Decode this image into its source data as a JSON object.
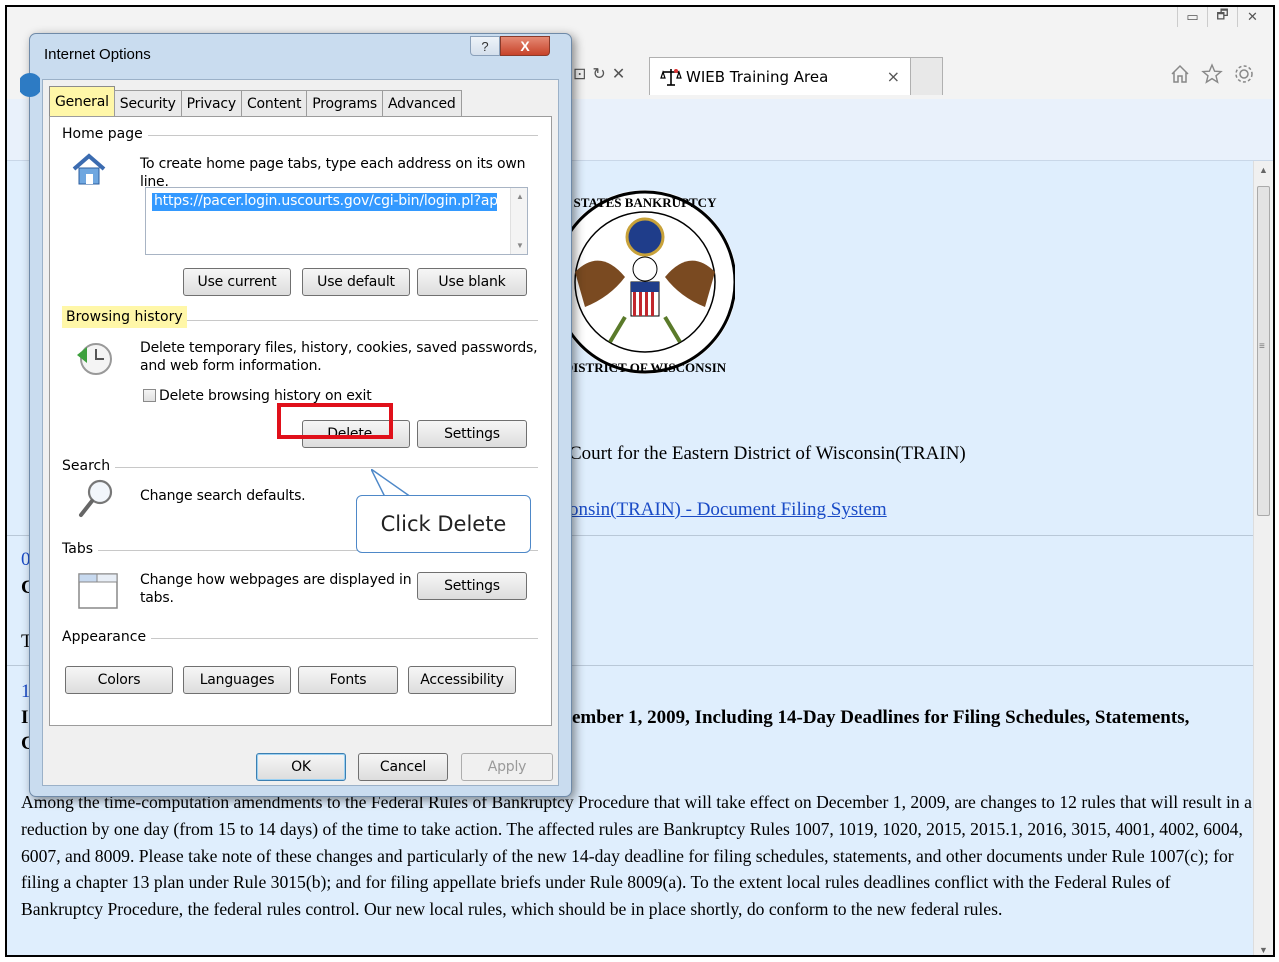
{
  "browser": {
    "window_controls": [
      "▭",
      "🗗",
      "✕"
    ],
    "tab_title": "WIEB Training Area",
    "tab_close": "×",
    "address_glyphs": [
      "⊡",
      "↻",
      "✕"
    ],
    "toolbar_icons": [
      "home-icon",
      "star-icon",
      "gear-icon"
    ]
  },
  "page": {
    "court_title": "Court for the Eastern District of Wisconsin(TRAIN)",
    "court_link": "onsin(TRAIN) - Document Filing System",
    "frag1": "0",
    "frag2": "C",
    "frag3": "T",
    "frag4": "1",
    "frag5": "I",
    "frag6": "C",
    "news_heading": "ember 1, 2009, Including 14-Day Deadlines for Filing Schedules, Statements,",
    "news_body_lead": "Among the time-computation amendments to the Federal Rules of Bankruptcy Procedure that will take effect on December 1, 2009, are changes to 12 rules that will result in a reduction by one day (from 15 to 14 days) of the time to take action. The affected rules are Bankruptcy Rules 1007, 1019, 1020, 2015, 2015.1, 2016, 3015, 4001, 4002, 6004, 6007, and 8009. Please take note of these changes and particularly of the new 14-day deadline for filing schedules, statements, and other documents under Rule 1007(c); for filing a chapter 13 plan under Rule 3015(b); and for filing appellate briefs under Rule 8009(a). To the extent local rules deadlines conflict with the Federal Rules of Bankruptcy Procedure, the federal rules control. Our new local rules, which should be in place shortly, do conform to the new federal rules."
  },
  "dialog": {
    "title": "Internet Options",
    "help": "?",
    "close": "X",
    "tabs": [
      "General",
      "Security",
      "Privacy",
      "Content",
      "Programs",
      "Advanced"
    ],
    "active_tab": "General",
    "home_page": {
      "label": "Home page",
      "instructions": "To create home page tabs, type each address on its own line.",
      "url": "https://pacer.login.uscourts.gov/cgi-bin/login.pl?appurl=",
      "use_current": "Use current",
      "use_default": "Use default",
      "use_blank": "Use blank"
    },
    "browsing_history": {
      "label": "Browsing history",
      "description_line1": "Delete temporary files, history, cookies, saved passwords,",
      "description_line2": "and web form information.",
      "checkbox_label": "Delete browsing history on exit",
      "checkbox_checked": false,
      "delete": "Delete...",
      "settings": "Settings"
    },
    "search": {
      "label": "Search",
      "description": "Change search defaults."
    },
    "tabs_group": {
      "label": "Tabs",
      "description_line1": "Change how webpages are displayed in",
      "description_line2": "tabs.",
      "settings": "Settings"
    },
    "appearance": {
      "label": "Appearance",
      "colors": "Colors",
      "languages": "Languages",
      "fonts": "Fonts",
      "accessibility": "Accessibility"
    },
    "ok": "OK",
    "cancel": "Cancel",
    "apply": "Apply"
  },
  "annotation": {
    "callout": "Click Delete",
    "highlight_color": "#fff7a8",
    "box_color": "#e0101a"
  }
}
